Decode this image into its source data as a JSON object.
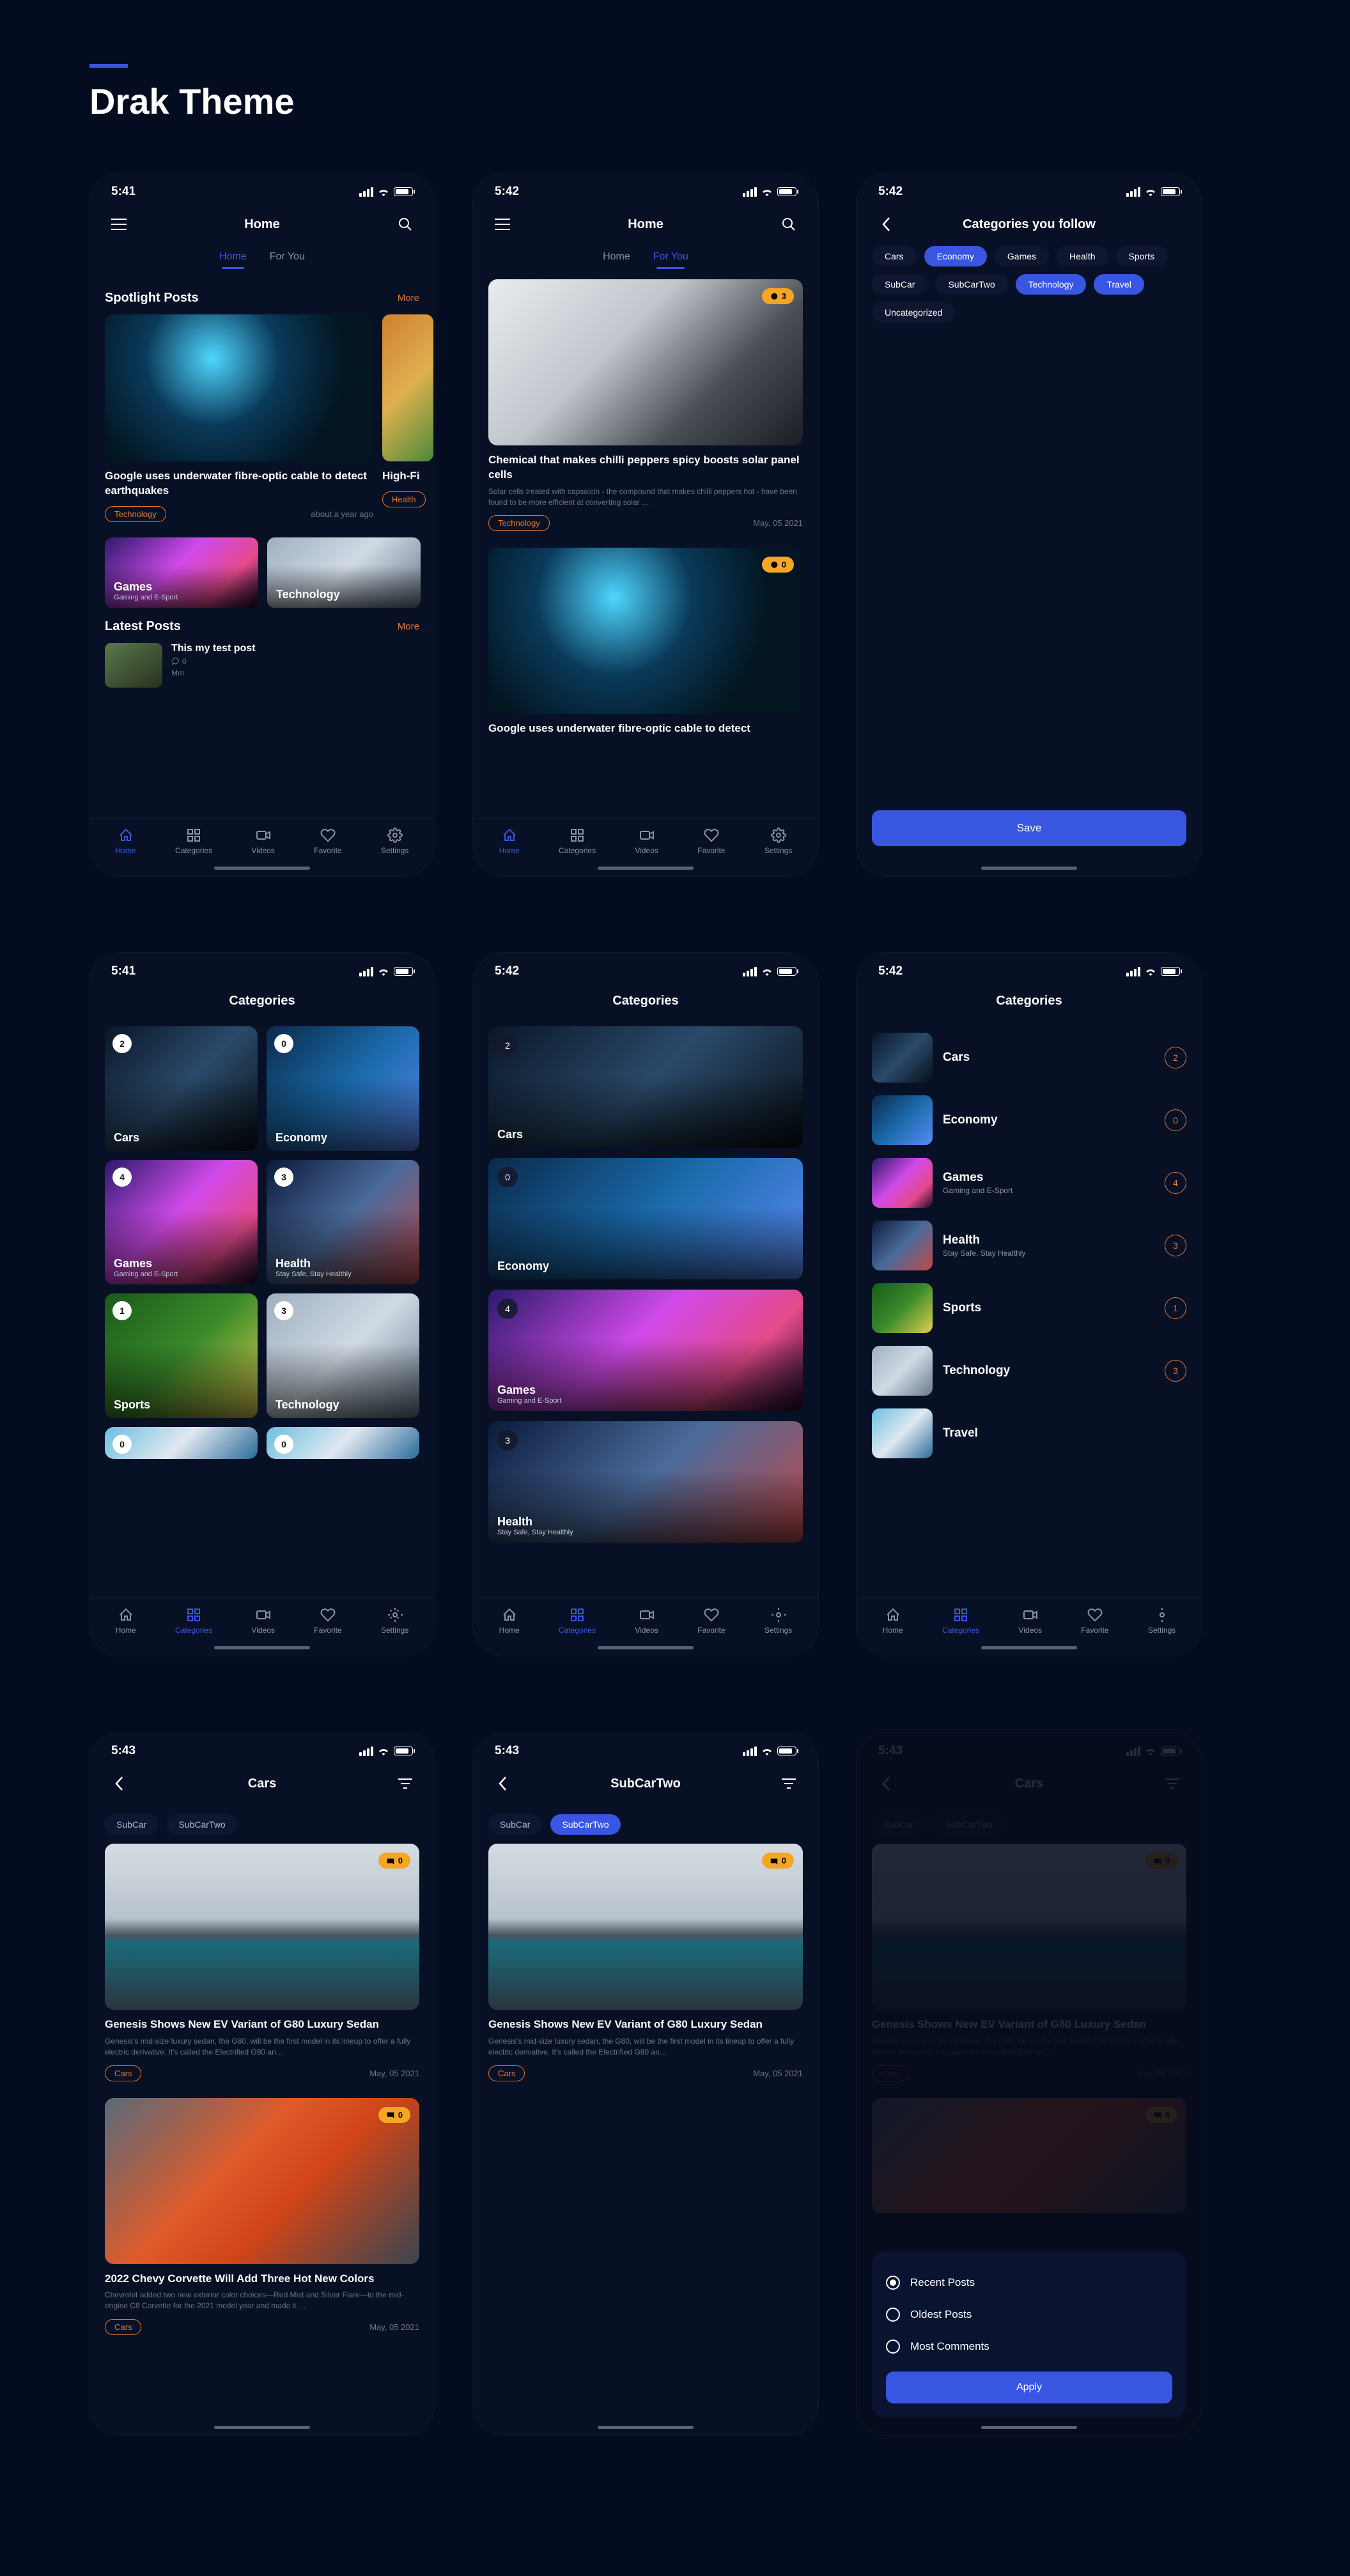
{
  "page_title": "Drak Theme",
  "status": {
    "time1": "5:41",
    "time2": "5:42",
    "time3": "5:43"
  },
  "nav": {
    "home": "Home",
    "categories": "Categories",
    "videos": "Videos",
    "favorite": "Favorite",
    "settings": "Settings"
  },
  "headers": {
    "home": "Home",
    "categories": "Categories",
    "categories_follow": "Categories you follow",
    "cars": "Cars",
    "subcartwo": "SubCarTwo"
  },
  "tabs_main": {
    "home": "Home",
    "for_you": "For You"
  },
  "sections": {
    "spotlight": "Spotlight Posts",
    "latest": "Latest Posts",
    "more": "More"
  },
  "spotlight": {
    "title1": "Google uses underwater fibre-optic cable to detect earthquakes",
    "title2_partial": "High-Fi",
    "tag": "Technology",
    "tag_partial": "Health",
    "ago": "about a year ago",
    "cat1": "Games",
    "cat1_sub": "Gaming and E-Sport",
    "cat2": "Technology"
  },
  "latest": {
    "title": "This my test post",
    "comments": "0",
    "author": "Mm"
  },
  "feed": {
    "p1_title": "Chemical that makes chilli peppers spicy boosts solar panel cells",
    "p1_desc": "Solar cells treated with capsaicin - the compound that makes chilli peppers hot - have been found to be more efficient at converting solar …",
    "p1_tag": "Technology",
    "p1_date": "May, 05 2021",
    "p1_badge": "3",
    "p2_title": "Google uses underwater fibre-optic cable to detect",
    "p2_badge": "0"
  },
  "chips": [
    "Cars",
    "Economy",
    "Games",
    "Health",
    "Sports",
    "SubCar",
    "SubCarTwo",
    "Technology",
    "Travel",
    "Uncategorized"
  ],
  "chips_active": [
    1,
    7,
    8
  ],
  "save": "Save",
  "categories": [
    {
      "name": "Cars",
      "sub": "",
      "count": "2",
      "bg": "bg-car-dark"
    },
    {
      "name": "Economy",
      "sub": "",
      "count": "0",
      "bg": "bg-econ"
    },
    {
      "name": "Games",
      "sub": "Gaming and E-Sport",
      "count": "4",
      "bg": "bg-games"
    },
    {
      "name": "Health",
      "sub": "Stay Safe, Stay Healthly",
      "count": "3",
      "bg": "bg-health"
    },
    {
      "name": "Sports",
      "sub": "",
      "count": "1",
      "bg": "bg-sports"
    },
    {
      "name": "Technology",
      "sub": "",
      "count": "3",
      "bg": "bg-tech"
    },
    {
      "name": "Travel",
      "sub": "",
      "count": "",
      "bg": "bg-travel"
    }
  ],
  "grid_extra": {
    "zero": "0"
  },
  "car_feed": {
    "subcar": "SubCar",
    "subcartwo": "SubCarTwo",
    "t1": "Genesis Shows New EV Variant of G80 Luxury Sedan",
    "d1": "Genesis's mid-size luxury sedan, the G80, will be the first model in its lineup to offer a fully electric derivative. It's called the Electrified G80 an…",
    "tag": "Cars",
    "date": "May, 05 2021",
    "badge": "0",
    "t2": "2022 Chevy Corvette Will Add Three Hot New Colors",
    "d2": "Chevrolet added two new exterior color choices—Red Mist and Silver Flare—to the mid-engine C8 Corvette for the 2021 model year and made it …"
  },
  "sort": {
    "recent": "Recent Posts",
    "oldest": "Oldest Posts",
    "most": "Most Comments",
    "apply": "Apply"
  }
}
